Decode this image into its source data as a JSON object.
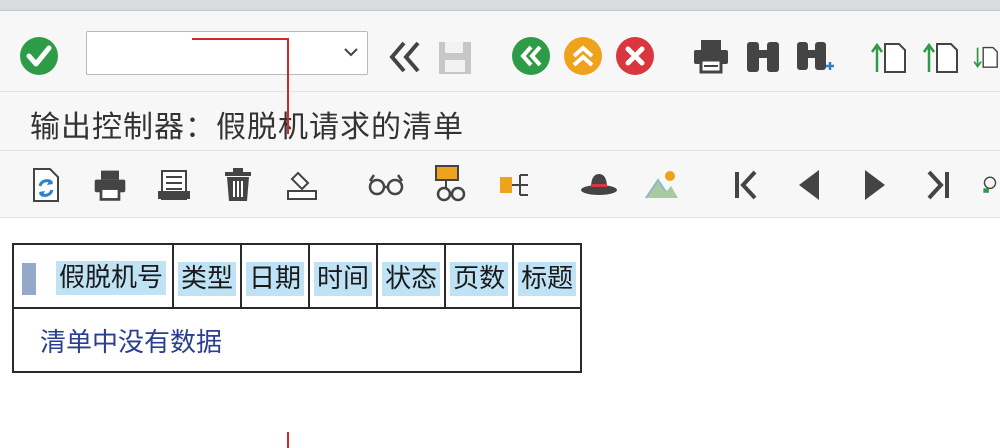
{
  "command_field": {
    "value": "",
    "placeholder": ""
  },
  "title": "输出控制器：假脱机请求的清单",
  "toolbar1": {
    "icons": [
      "enter-icon",
      "back-double-icon",
      "save-icon",
      "back-icon",
      "exit-icon",
      "cancel-icon",
      "print-icon",
      "find-icon",
      "find-next-icon",
      "first-page-icon",
      "previous-page-icon",
      "next-page-icon"
    ]
  },
  "toolbar2": {
    "icons": [
      "refresh-icon",
      "print-icon",
      "display-contents-icon",
      "delete-icon",
      "output-request-icon",
      "display-icon",
      "attributes-icon",
      "hierarchy-icon",
      "hat-icon",
      "image-icon",
      "first-icon",
      "previous-icon",
      "next-icon",
      "last-icon",
      "more-icon"
    ]
  },
  "table": {
    "columns": [
      "假脱机号",
      "类型",
      "日期",
      "时间",
      "状态",
      "页数",
      "标题"
    ],
    "empty_message": "清单中没有数据"
  },
  "colors": {
    "accent_green": "#2e9b46",
    "accent_orange": "#efa21b",
    "accent_red": "#d9363e",
    "header_highlight": "#bfe3f5",
    "empty_text": "#2a3f8f"
  }
}
